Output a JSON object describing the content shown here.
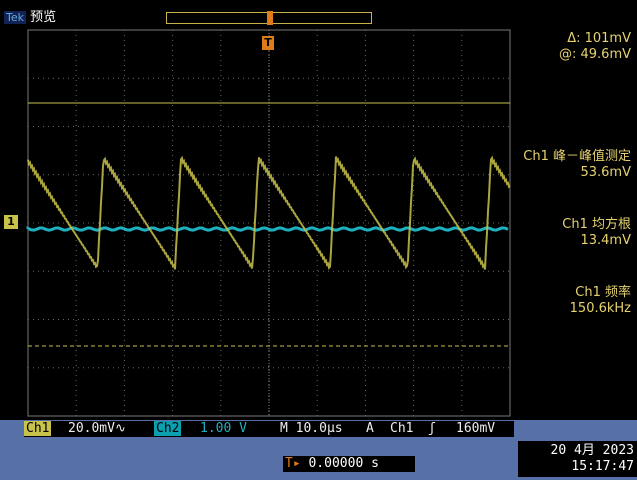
{
  "topbar": {
    "brand_tek": "Tek",
    "brand_mode": "预览"
  },
  "cursors": {
    "delta": "Δ:   101mV",
    "at": "@:   49.6mV"
  },
  "measurements": [
    {
      "label": "Ch1 峰－峰值测定",
      "value": "53.6mV"
    },
    {
      "label": "Ch1 均方根",
      "value": "13.4mV"
    },
    {
      "label": "Ch1 频率",
      "value": "150.6kHz"
    }
  ],
  "status": {
    "ch1": "Ch1",
    "ch1_scale": "20.0mV∿",
    "ch2": "Ch2",
    "ch2_scale": "1.00 V",
    "timebase": "M 10.0µs",
    "acq": "A",
    "trig_ch": "Ch1",
    "trig_slope": "ʃ",
    "trig_level": "160mV"
  },
  "trigger_pos": "0.00000 s",
  "datetime": {
    "date": "20 4月  2023",
    "time": "15:17:47"
  },
  "markers": {
    "ch1_ground": "1",
    "trigger_top": "T"
  },
  "colors": {
    "ch1": "#c9c24a",
    "ch2": "#1fb0c0",
    "grid": "#555"
  }
}
